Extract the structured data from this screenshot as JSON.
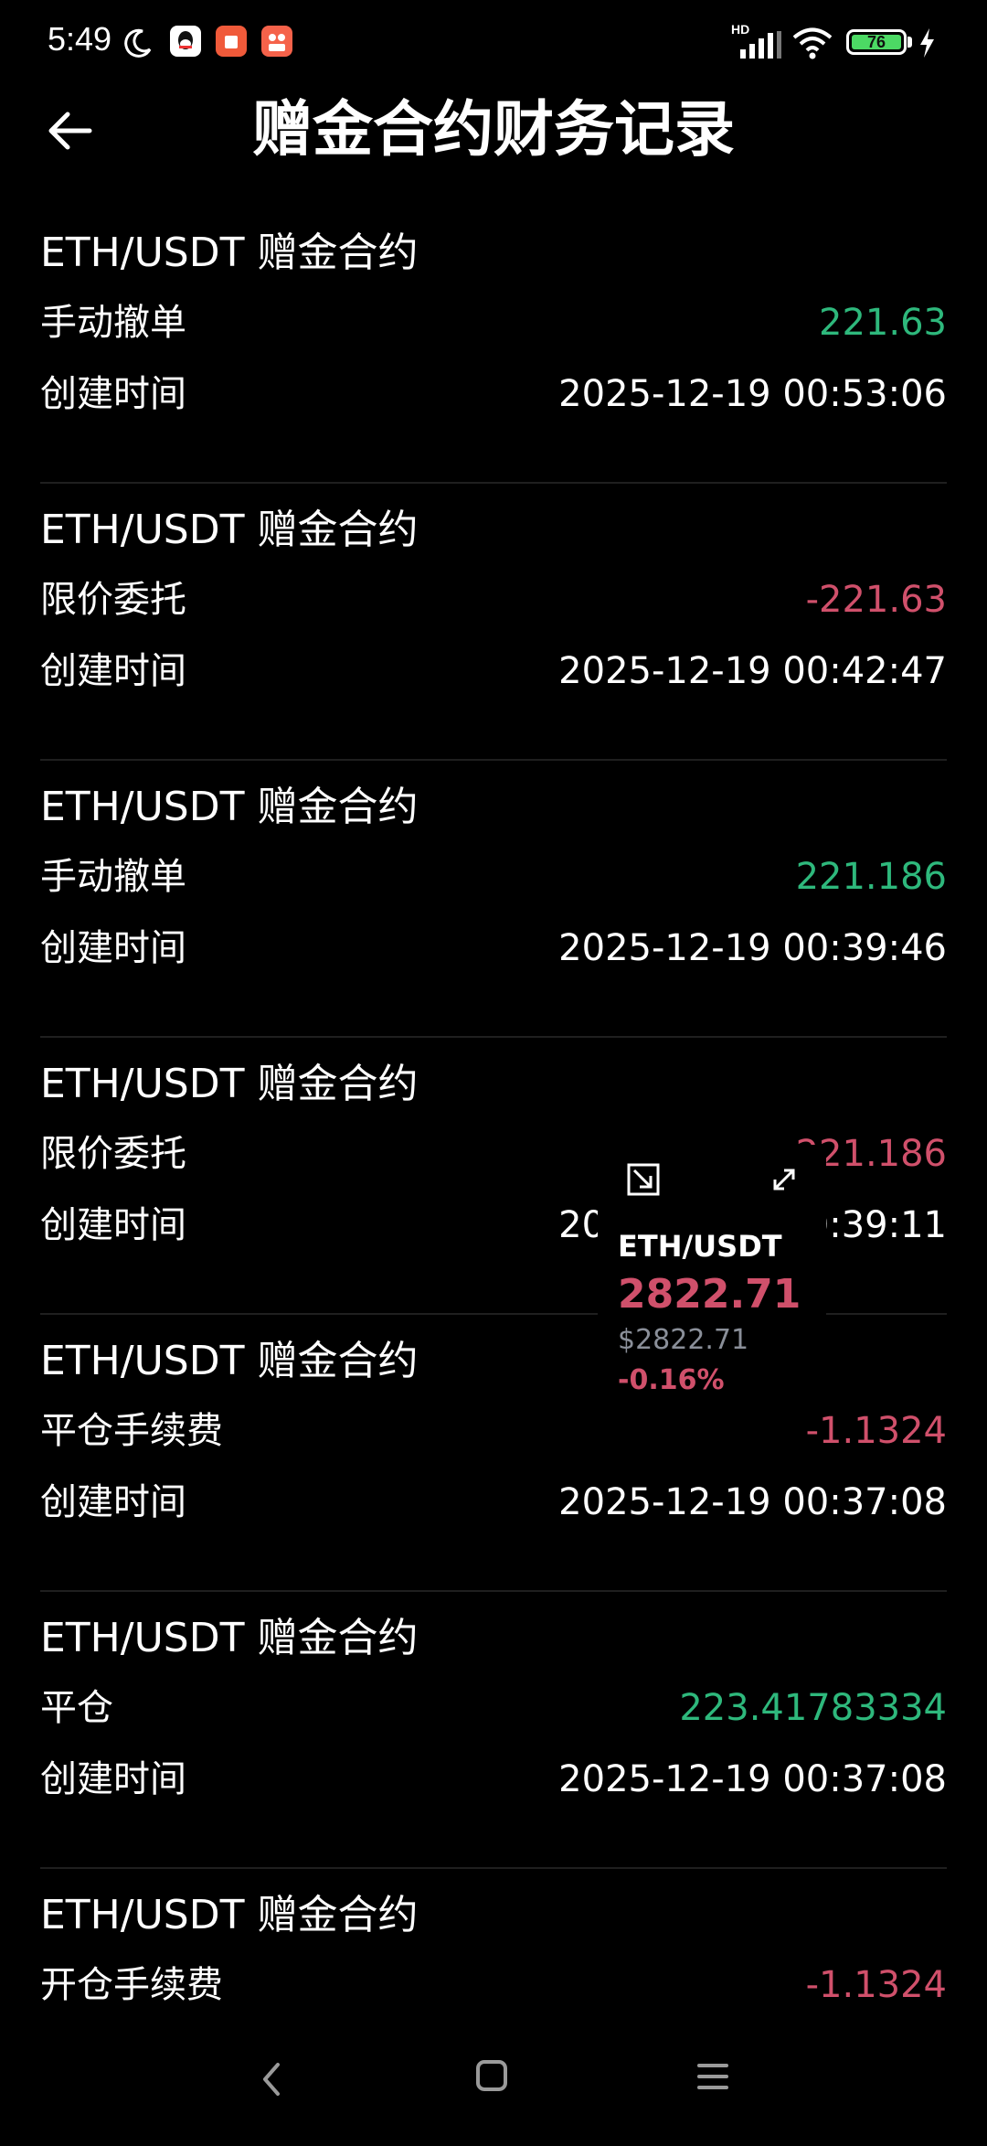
{
  "status_bar": {
    "time": "5:49",
    "hd": "HD",
    "battery": "76"
  },
  "header": {
    "title": "赠金合约财务记录"
  },
  "labels": {
    "created_time": "创建时间"
  },
  "records": [
    {
      "title": "ETH/USDT 赠金合约",
      "type": "手动撤单",
      "amount": "221.63",
      "time": "2025-12-19 00:53:06"
    },
    {
      "title": "ETH/USDT 赠金合约",
      "type": "限价委托",
      "amount": "-221.63",
      "time": "2025-12-19 00:42:47"
    },
    {
      "title": "ETH/USDT 赠金合约",
      "type": "手动撤单",
      "amount": "221.186",
      "time": "2025-12-19 00:39:46"
    },
    {
      "title": "ETH/USDT 赠金合约",
      "type": "限价委托",
      "amount": "-221.186",
      "time": "2025-12-19 00:39:11"
    },
    {
      "title": "ETH/USDT 赠金合约",
      "type": "平仓手续费",
      "amount": "-1.1324",
      "time": "2025-12-19 00:37:08"
    },
    {
      "title": "ETH/USDT 赠金合约",
      "type": "平仓",
      "amount": "223.41783334",
      "time": "2025-12-19 00:37:08"
    },
    {
      "title": "ETH/USDT 赠金合约",
      "type": "开仓手续费",
      "amount": "-1.1324",
      "time": ""
    }
  ],
  "price_widget": {
    "symbol": "ETH/USDT",
    "price": "2822.71",
    "usd_price": "$2822.71",
    "change": "-0.16%"
  },
  "colors": {
    "positive": "#2eb87c",
    "negative": "#d0506b",
    "background": "#000000"
  }
}
